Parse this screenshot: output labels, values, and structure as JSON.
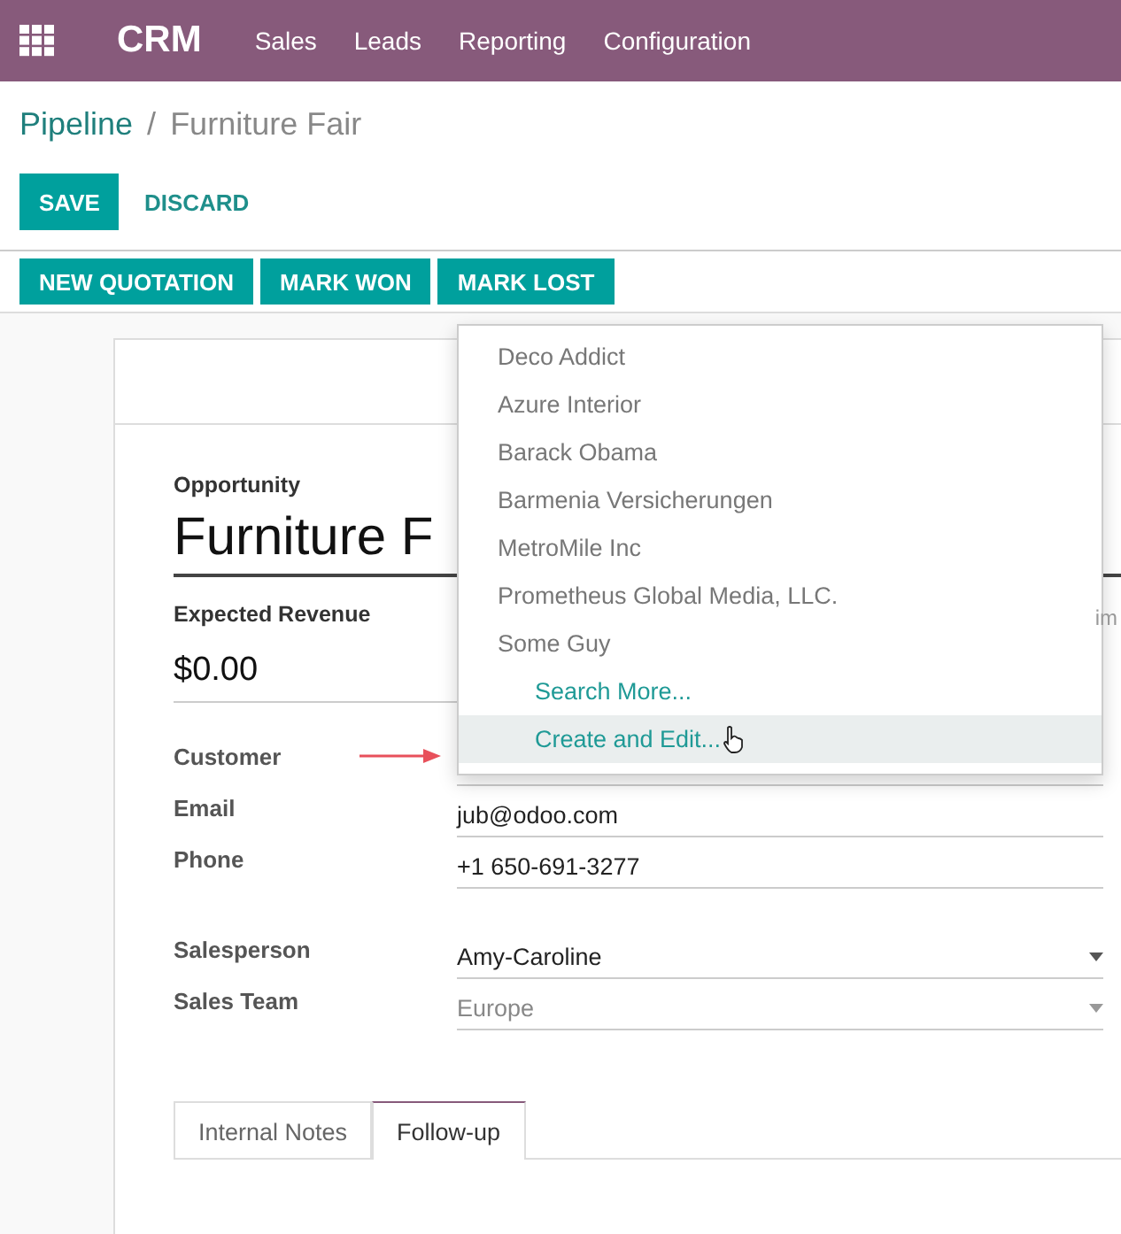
{
  "navbar": {
    "app_name": "CRM",
    "menu": [
      "Sales",
      "Leads",
      "Reporting",
      "Configuration"
    ]
  },
  "breadcrumb": {
    "parent": "Pipeline",
    "separator": "/",
    "current": "Furniture Fair"
  },
  "form_buttons": [
    {
      "label": "SAVE",
      "kind": "primary"
    },
    {
      "label": "DISCARD",
      "kind": "link"
    }
  ],
  "action_buttons": [
    "NEW QUOTATION",
    "MARK WON",
    "MARK LOST"
  ],
  "form": {
    "title_label": "Opportunity",
    "title_value": "Furniture F",
    "revenue_label": "Expected Revenue",
    "revenue_value": "$0.00",
    "cut_label": "im",
    "fields": [
      {
        "label": "Customer",
        "kind": "select",
        "annotated": true
      },
      {
        "label": "Email",
        "value": "jub@odoo.com",
        "kind": "text",
        "annotated": false
      },
      {
        "label": "Phone",
        "value": "+1 650-691-3277",
        "kind": "text",
        "annotated": false
      },
      {
        "label": "Salesperson",
        "value": "Amy-Caroline",
        "kind": "select",
        "annotated": false
      },
      {
        "label": "Sales Team",
        "value": "Europe",
        "kind": "select-muted",
        "annotated": false
      }
    ],
    "tabs": [
      {
        "label": "Internal Notes",
        "selected": false
      },
      {
        "label": "Follow-up",
        "selected": true
      }
    ]
  },
  "dropdown": {
    "items": [
      {
        "label": "Deco Addict",
        "kind": "option",
        "selected": false
      },
      {
        "label": "Azure Interior",
        "kind": "option",
        "selected": false
      },
      {
        "label": "Barack Obama",
        "kind": "option",
        "selected": false
      },
      {
        "label": "Barmenia Versicherungen",
        "kind": "option",
        "selected": false
      },
      {
        "label": "MetroMile Inc",
        "kind": "option",
        "selected": false
      },
      {
        "label": "Prometheus Global Media, LLC.",
        "kind": "option",
        "selected": false
      },
      {
        "label": "Some Guy",
        "kind": "option",
        "selected": false
      },
      {
        "label": "Search More...",
        "kind": "action",
        "selected": false
      },
      {
        "label": "Create and Edit...",
        "kind": "action",
        "selected": true
      }
    ]
  }
}
